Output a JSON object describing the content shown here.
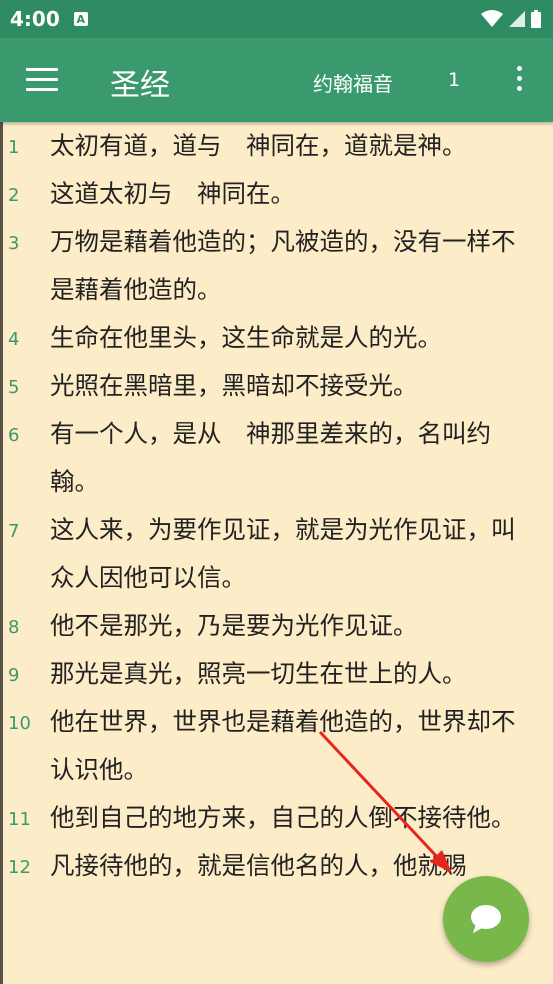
{
  "status": {
    "time": "4:00",
    "notif_glyph": "A"
  },
  "app_bar": {
    "title": "圣经",
    "book": "约翰福音",
    "chapter": "1"
  },
  "verses": [
    {
      "num": "1",
      "text": "太初有道，道与　神同在，道就是神。"
    },
    {
      "num": "2",
      "text": "这道太初与　神同在。"
    },
    {
      "num": "3",
      "text": "万物是藉着他造的；凡被造的，没有一样不是藉着他造的。"
    },
    {
      "num": "4",
      "text": "生命在他里头，这生命就是人的光。"
    },
    {
      "num": "5",
      "text": "光照在黑暗里，黑暗却不接受光。"
    },
    {
      "num": "6",
      "text": "有一个人，是从　神那里差来的，名叫约翰。"
    },
    {
      "num": "7",
      "text": "这人来，为要作见证，就是为光作见证，叫众人因他可以信。"
    },
    {
      "num": "8",
      "text": "他不是那光，乃是要为光作见证。"
    },
    {
      "num": "9",
      "text": "那光是真光，照亮一切生在世上的人。"
    },
    {
      "num": "10",
      "text": "他在世界，世界也是藉着他造的，世界却不认识他。"
    },
    {
      "num": "11",
      "text": "他到自己的地方来，自己的人倒不接待他。"
    },
    {
      "num": "12",
      "text": "凡接待他的，就是信他名的人，他就赐"
    }
  ],
  "colors": {
    "status_bar": "#2f8c62",
    "app_bar": "#3a9a6e",
    "background": "#fdecc8",
    "fab": "#78b84a",
    "verse_num": "#3a9a6e"
  },
  "icons": {
    "menu": "hamburger-icon",
    "more": "more-vert-icon",
    "fab": "chat-bubble-icon",
    "wifi": "wifi-icon",
    "signal": "signal-icon",
    "battery": "battery-icon"
  }
}
